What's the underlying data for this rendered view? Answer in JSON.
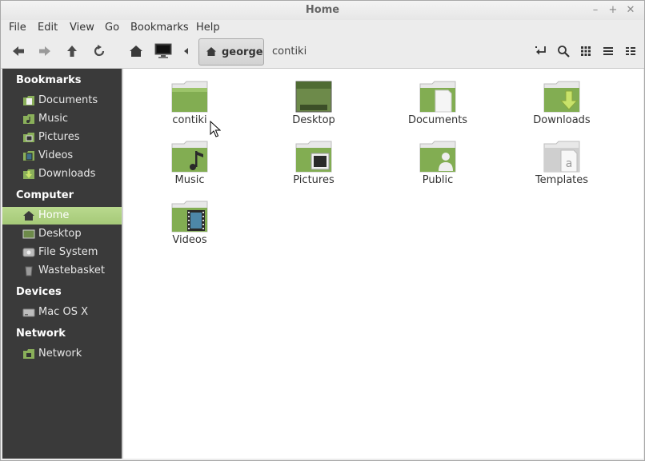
{
  "window": {
    "title": "Home"
  },
  "menubar": [
    "File",
    "Edit",
    "View",
    "Go",
    "Bookmarks",
    "Help"
  ],
  "path": {
    "current": "george",
    "next": "contiki"
  },
  "sidebar": {
    "bookmarks_heading": "Bookmarks",
    "bookmarks": [
      "Documents",
      "Music",
      "Pictures",
      "Videos",
      "Downloads"
    ],
    "computer_heading": "Computer",
    "computer": [
      "Home",
      "Desktop",
      "File System",
      "Wastebasket"
    ],
    "devices_heading": "Devices",
    "devices": [
      "Mac OS X"
    ],
    "network_heading": "Network",
    "network": [
      "Network"
    ]
  },
  "files": [
    "contiki",
    "Desktop",
    "Documents",
    "Downloads",
    "Music",
    "Pictures",
    "Public",
    "Templates",
    "Videos"
  ],
  "colors": {
    "accent": "#a5c978",
    "folder": "#8ab05a",
    "sidebar": "#3a3a3a"
  },
  "icons": {
    "toolbar": [
      "back-arrow-icon",
      "forward-arrow-icon",
      "up-arrow-icon",
      "reload-icon",
      "home-icon",
      "computer-icon",
      "path-left-arrow-icon",
      "toggle-location-icon",
      "search-icon",
      "icon-view-icon",
      "list-view-icon",
      "compact-view-icon"
    ]
  }
}
